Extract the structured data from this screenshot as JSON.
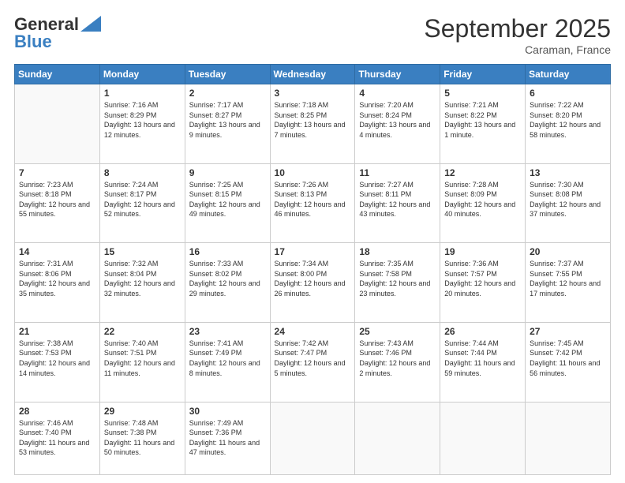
{
  "header": {
    "logo_general": "General",
    "logo_blue": "Blue",
    "month_title": "September 2025",
    "location": "Caraman, France"
  },
  "days_of_week": [
    "Sunday",
    "Monday",
    "Tuesday",
    "Wednesday",
    "Thursday",
    "Friday",
    "Saturday"
  ],
  "weeks": [
    [
      {
        "day": "",
        "info": ""
      },
      {
        "day": "1",
        "info": "Sunrise: 7:16 AM\nSunset: 8:29 PM\nDaylight: 13 hours and 12 minutes."
      },
      {
        "day": "2",
        "info": "Sunrise: 7:17 AM\nSunset: 8:27 PM\nDaylight: 13 hours and 9 minutes."
      },
      {
        "day": "3",
        "info": "Sunrise: 7:18 AM\nSunset: 8:25 PM\nDaylight: 13 hours and 7 minutes."
      },
      {
        "day": "4",
        "info": "Sunrise: 7:20 AM\nSunset: 8:24 PM\nDaylight: 13 hours and 4 minutes."
      },
      {
        "day": "5",
        "info": "Sunrise: 7:21 AM\nSunset: 8:22 PM\nDaylight: 13 hours and 1 minute."
      },
      {
        "day": "6",
        "info": "Sunrise: 7:22 AM\nSunset: 8:20 PM\nDaylight: 12 hours and 58 minutes."
      }
    ],
    [
      {
        "day": "7",
        "info": "Sunrise: 7:23 AM\nSunset: 8:18 PM\nDaylight: 12 hours and 55 minutes."
      },
      {
        "day": "8",
        "info": "Sunrise: 7:24 AM\nSunset: 8:17 PM\nDaylight: 12 hours and 52 minutes."
      },
      {
        "day": "9",
        "info": "Sunrise: 7:25 AM\nSunset: 8:15 PM\nDaylight: 12 hours and 49 minutes."
      },
      {
        "day": "10",
        "info": "Sunrise: 7:26 AM\nSunset: 8:13 PM\nDaylight: 12 hours and 46 minutes."
      },
      {
        "day": "11",
        "info": "Sunrise: 7:27 AM\nSunset: 8:11 PM\nDaylight: 12 hours and 43 minutes."
      },
      {
        "day": "12",
        "info": "Sunrise: 7:28 AM\nSunset: 8:09 PM\nDaylight: 12 hours and 40 minutes."
      },
      {
        "day": "13",
        "info": "Sunrise: 7:30 AM\nSunset: 8:08 PM\nDaylight: 12 hours and 37 minutes."
      }
    ],
    [
      {
        "day": "14",
        "info": "Sunrise: 7:31 AM\nSunset: 8:06 PM\nDaylight: 12 hours and 35 minutes."
      },
      {
        "day": "15",
        "info": "Sunrise: 7:32 AM\nSunset: 8:04 PM\nDaylight: 12 hours and 32 minutes."
      },
      {
        "day": "16",
        "info": "Sunrise: 7:33 AM\nSunset: 8:02 PM\nDaylight: 12 hours and 29 minutes."
      },
      {
        "day": "17",
        "info": "Sunrise: 7:34 AM\nSunset: 8:00 PM\nDaylight: 12 hours and 26 minutes."
      },
      {
        "day": "18",
        "info": "Sunrise: 7:35 AM\nSunset: 7:58 PM\nDaylight: 12 hours and 23 minutes."
      },
      {
        "day": "19",
        "info": "Sunrise: 7:36 AM\nSunset: 7:57 PM\nDaylight: 12 hours and 20 minutes."
      },
      {
        "day": "20",
        "info": "Sunrise: 7:37 AM\nSunset: 7:55 PM\nDaylight: 12 hours and 17 minutes."
      }
    ],
    [
      {
        "day": "21",
        "info": "Sunrise: 7:38 AM\nSunset: 7:53 PM\nDaylight: 12 hours and 14 minutes."
      },
      {
        "day": "22",
        "info": "Sunrise: 7:40 AM\nSunset: 7:51 PM\nDaylight: 12 hours and 11 minutes."
      },
      {
        "day": "23",
        "info": "Sunrise: 7:41 AM\nSunset: 7:49 PM\nDaylight: 12 hours and 8 minutes."
      },
      {
        "day": "24",
        "info": "Sunrise: 7:42 AM\nSunset: 7:47 PM\nDaylight: 12 hours and 5 minutes."
      },
      {
        "day": "25",
        "info": "Sunrise: 7:43 AM\nSunset: 7:46 PM\nDaylight: 12 hours and 2 minutes."
      },
      {
        "day": "26",
        "info": "Sunrise: 7:44 AM\nSunset: 7:44 PM\nDaylight: 11 hours and 59 minutes."
      },
      {
        "day": "27",
        "info": "Sunrise: 7:45 AM\nSunset: 7:42 PM\nDaylight: 11 hours and 56 minutes."
      }
    ],
    [
      {
        "day": "28",
        "info": "Sunrise: 7:46 AM\nSunset: 7:40 PM\nDaylight: 11 hours and 53 minutes."
      },
      {
        "day": "29",
        "info": "Sunrise: 7:48 AM\nSunset: 7:38 PM\nDaylight: 11 hours and 50 minutes."
      },
      {
        "day": "30",
        "info": "Sunrise: 7:49 AM\nSunset: 7:36 PM\nDaylight: 11 hours and 47 minutes."
      },
      {
        "day": "",
        "info": ""
      },
      {
        "day": "",
        "info": ""
      },
      {
        "day": "",
        "info": ""
      },
      {
        "day": "",
        "info": ""
      }
    ]
  ]
}
